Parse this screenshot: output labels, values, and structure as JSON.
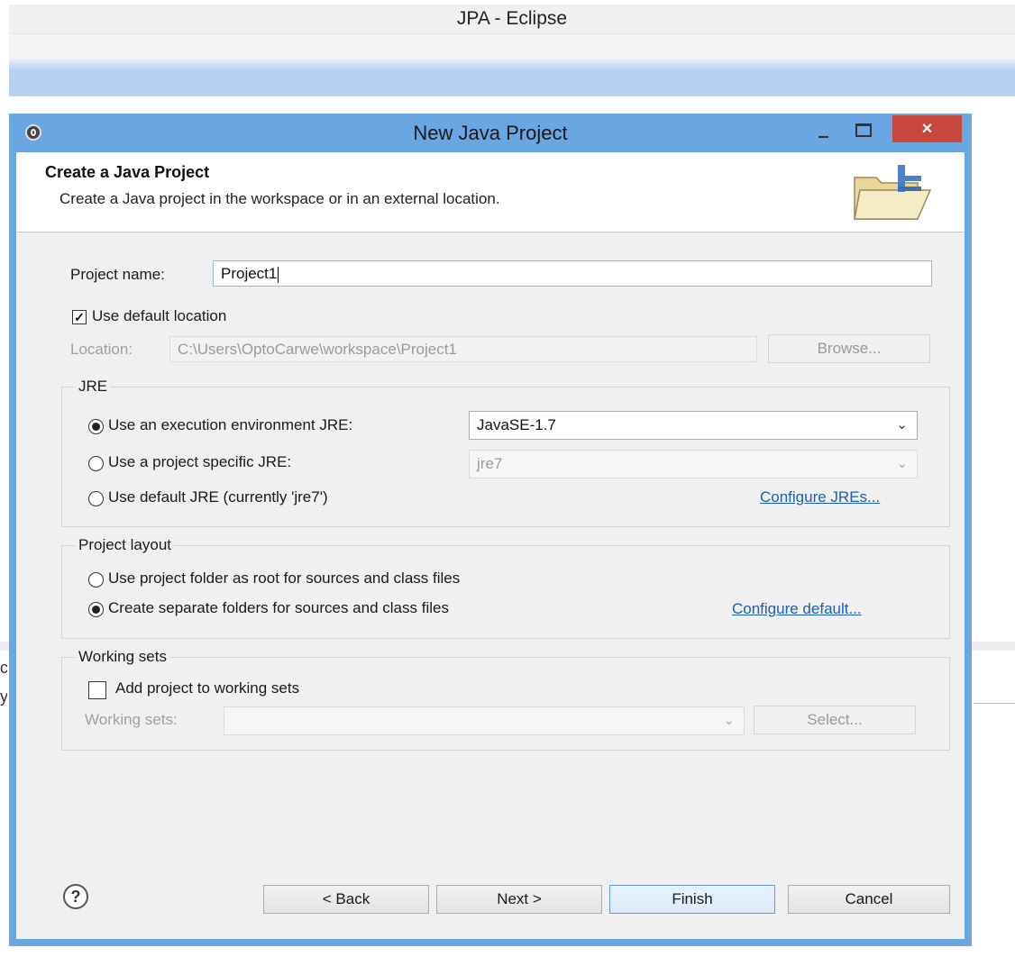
{
  "app": {
    "window_title": "JPA - Eclipse"
  },
  "dialog": {
    "title": "New Java Project",
    "close_glyph": "×",
    "banner": {
      "title": "Create a Java Project",
      "description": "Create a Java project in the workspace or in an external location."
    },
    "project_name": {
      "label": "Project name:",
      "value": "Project1"
    },
    "use_default_location": {
      "label": "Use default location",
      "checked": true
    },
    "location": {
      "label": "Location:",
      "value": "C:\\Users\\OptoCarwe\\workspace\\Project1",
      "browse_label": "Browse..."
    },
    "jre": {
      "group_title": "JRE",
      "option_exec_env": "Use an execution environment JRE:",
      "exec_env_value": "JavaSE-1.7",
      "option_project_specific": "Use a project specific JRE:",
      "project_specific_value": "jre7",
      "option_default": "Use default JRE (currently 'jre7')",
      "configure_link": "Configure JREs...",
      "selected": "exec_env"
    },
    "layout": {
      "group_title": "Project layout",
      "option_root": "Use project folder as root for sources and class files",
      "option_separate": "Create separate folders for sources and class files",
      "configure_link": "Configure default...",
      "selected": "separate"
    },
    "working_sets": {
      "group_title": "Working sets",
      "add_label": "Add project to working sets",
      "checked": false,
      "sets_label": "Working sets:",
      "select_label": "Select..."
    },
    "footer": {
      "help_glyph": "?",
      "back_label": "< Back",
      "next_label": "Next >",
      "finish_label": "Finish",
      "cancel_label": "Cancel"
    }
  },
  "background_fragments": [
    "c",
    "y"
  ],
  "colors": {
    "dialog_border": "#6aa6e2",
    "close_button": "#c7473d",
    "link": "#1b5fb8"
  }
}
